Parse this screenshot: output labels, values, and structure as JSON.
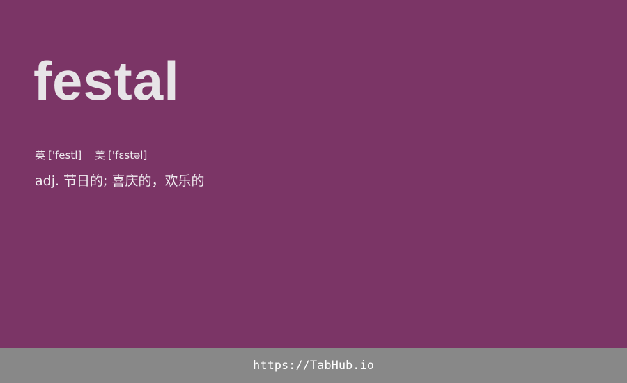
{
  "word": "festal",
  "phonetics": {
    "uk": {
      "label": "英",
      "ipa": "['festl]"
    },
    "us": {
      "label": "美",
      "ipa": "['fɛstəl]"
    }
  },
  "definition": "adj. 节日的; 喜庆的，欢乐的",
  "footer": {
    "link_text": "https://TabHub.io"
  },
  "colors": {
    "background": "#7b3566",
    "footer_background": "#888888",
    "text": "#e7e4e7"
  }
}
